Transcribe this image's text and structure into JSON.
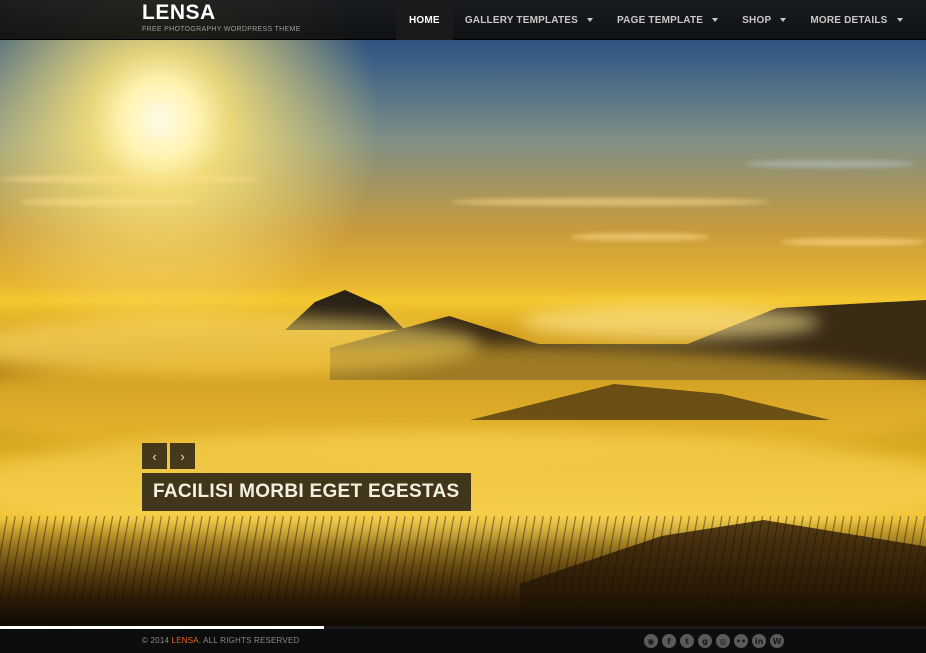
{
  "brand": {
    "title": "LENSA",
    "tagline": "FREE PHOTOGRAPHY WORDPRESS THEME"
  },
  "nav": {
    "items": [
      {
        "label": "HOME",
        "active": true,
        "has_dropdown": false
      },
      {
        "label": "GALLERY TEMPLATES",
        "active": false,
        "has_dropdown": true
      },
      {
        "label": "PAGE TEMPLATE",
        "active": false,
        "has_dropdown": true
      },
      {
        "label": "SHOP",
        "active": false,
        "has_dropdown": true
      },
      {
        "label": "MORE DETAILS",
        "active": false,
        "has_dropdown": true
      }
    ]
  },
  "slider": {
    "prev_icon": "‹",
    "next_icon": "›",
    "caption": "FACILISI MORBI EGET EGESTAS",
    "progress_percent": 35
  },
  "footer": {
    "copyright_prefix": "© 2014 ",
    "copyright_brand": "LENSA",
    "copyright_suffix": ". ALL RIGHTS RESERVED",
    "accent_color": "#e8632a",
    "socials": [
      {
        "name": "rss-icon",
        "glyph": "◉"
      },
      {
        "name": "facebook-icon",
        "glyph": "f"
      },
      {
        "name": "twitter-icon",
        "glyph": "t"
      },
      {
        "name": "google-plus-icon",
        "glyph": "g"
      },
      {
        "name": "dribbble-icon",
        "glyph": "◎"
      },
      {
        "name": "flickr-icon",
        "glyph": "••"
      },
      {
        "name": "linkedin-icon",
        "glyph": "in"
      },
      {
        "name": "wordpress-icon",
        "glyph": "W"
      }
    ]
  }
}
